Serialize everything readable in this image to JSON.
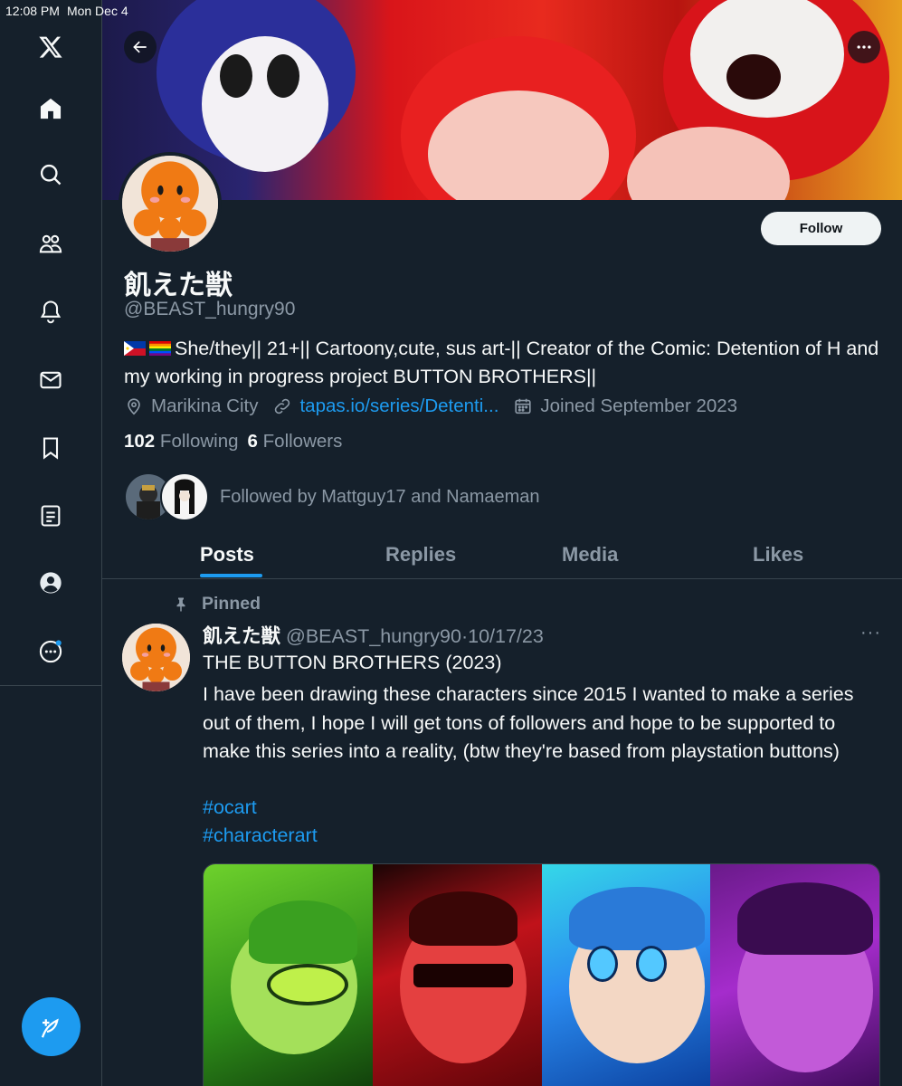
{
  "status_bar": {
    "time": "12:08 PM",
    "date": "Mon Dec 4"
  },
  "sidebar": {
    "items": [
      {
        "name": "x-logo-icon"
      },
      {
        "name": "home-icon"
      },
      {
        "name": "search-icon"
      },
      {
        "name": "communities-icon"
      },
      {
        "name": "notifications-icon"
      },
      {
        "name": "messages-icon"
      },
      {
        "name": "bookmarks-icon"
      },
      {
        "name": "lists-icon"
      },
      {
        "name": "profile-icon"
      },
      {
        "name": "more-icon"
      }
    ],
    "compose_icon": "compose-icon"
  },
  "profile": {
    "display_name": "飢えた獣",
    "handle": "@BEAST_hungry90",
    "bio": "She/they|| 21+|| Cartoony,cute, sus art-|| Creator of the Comic: Detention of H and my working in progress project BUTTON BROTHERS||",
    "location": "Marikina City",
    "link": "tapas.io/series/Detenti...",
    "joined": "Joined September 2023",
    "following_count": "102",
    "following_label": "Following",
    "followers_count": "6",
    "followers_label": "Followers",
    "followed_by": "Followed by Mattguy17 and Namaeman",
    "follow_button": "Follow"
  },
  "tabs": [
    "Posts",
    "Replies",
    "Media",
    "Likes"
  ],
  "active_tab": "Posts",
  "pinned_post": {
    "pinned_label": "Pinned",
    "author_name": "飢えた獣",
    "author_handle": "@BEAST_hungry90",
    "separator": "·",
    "date": "10/17/23",
    "more": "···",
    "title": "THE BUTTON BROTHERS (2023)",
    "body": " I have been drawing these characters since 2015 I wanted to make a series out of them, I hope I will get tons of followers and hope to be supported to make this series into a reality, (btw they're based from playstation buttons)",
    "hashtags": [
      "#ocart",
      "#characterart"
    ]
  },
  "colors": {
    "background": "#15202b",
    "accent": "#1d9bf0",
    "muted_text": "#8b98a5",
    "border": "#38444d"
  }
}
